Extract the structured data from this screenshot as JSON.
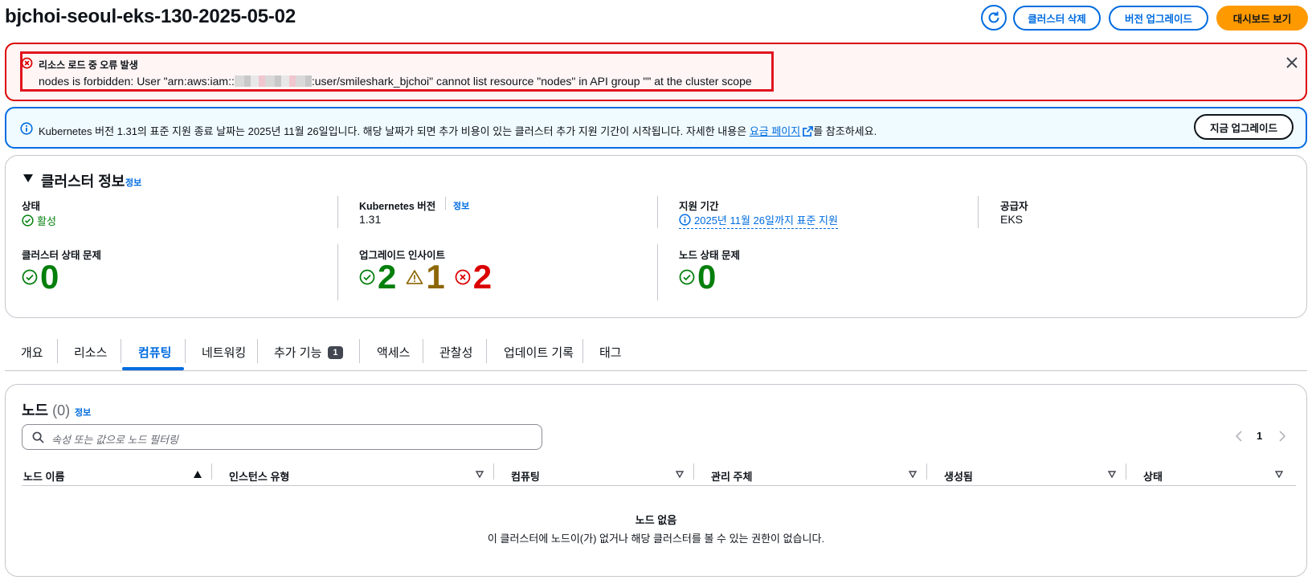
{
  "header": {
    "title": "bjchoi-seoul-eks-130-2025-05-02",
    "delete_label": "클러스터 삭제",
    "upgrade_label": "버전 업그레이드",
    "dashboard_label": "대시보드 보기"
  },
  "error_alert": {
    "title": "리소스 로드 중 오류 발생",
    "msg_pre": "nodes is forbidden: User \"arn:aws:iam::",
    "msg_post": ":user/smileshark_bjchoi\" cannot list resource \"nodes\" in API group \"\" at the cluster scope"
  },
  "info_alert": {
    "text_pre": "Kubernetes 버전 1.31의 표준 지원 종료 날짜는 2025년 11월 26일입니다. 해당 날짜가 되면 추가 비용이 있는 클러스터 추가 지원 기간이 시작됩니다. 자세한 내용은 ",
    "link": "요금 페이지",
    "text_post": "를 참조하세요.",
    "button": "지금 업그레이드"
  },
  "cluster_info": {
    "title": "클러스터 정보",
    "info": "정보",
    "status_label": "상태",
    "status_value": "활성",
    "k8s_label": "Kubernetes 버전",
    "k8s_info": "정보",
    "k8s_value": "1.31",
    "support_label": "지원 기간",
    "support_value": "2025년 11월 26일까지 표준 지원",
    "provider_label": "공급자",
    "provider_value": "EKS",
    "health_label": "클러스터 상태 문제",
    "health_value": "0",
    "insights_label": "업그레이드 인사이트",
    "insights_passing": "2",
    "insights_warning": "1",
    "insights_error": "2",
    "node_health_label": "노드 상태 문제",
    "node_health_value": "0"
  },
  "tabs": [
    {
      "label": "개요"
    },
    {
      "label": "리소스"
    },
    {
      "label": "컴퓨팅"
    },
    {
      "label": "네트워킹"
    },
    {
      "label": "추가 기능",
      "badge": "1"
    },
    {
      "label": "액세스"
    },
    {
      "label": "관찰성"
    },
    {
      "label": "업데이트 기록"
    },
    {
      "label": "태그"
    }
  ],
  "nodes": {
    "title": "노드",
    "count": "(0)",
    "info": "정보",
    "search_placeholder": "속성 또는 값으로 노드 필터링",
    "page": "1",
    "columns": [
      "노드 이름",
      "인스턴스 유형",
      "컴퓨팅",
      "관리 주체",
      "생성됨",
      "상태"
    ],
    "empty_title": "노드 없음",
    "empty_msg": "이 클러스터에 노드이(가) 없거나 해당 클러스터를 볼 수 있는 권한이 없습니다."
  },
  "colors": {
    "accent": "#006ce0",
    "primary": "#ff9900",
    "error": "#db0000",
    "success": "#037f0c",
    "warning": "#8d6605"
  }
}
